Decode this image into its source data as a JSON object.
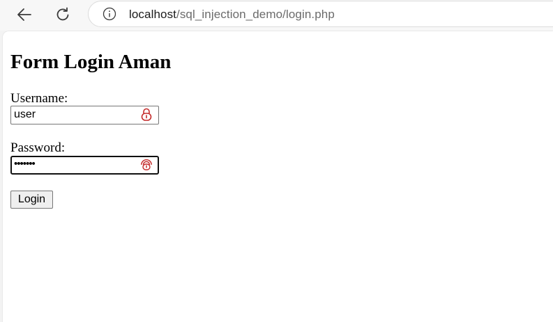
{
  "browser": {
    "url_host": "localhost",
    "url_path": "/sql_injection_demo/login.php"
  },
  "page": {
    "title": "Form Login Aman",
    "username_label": "Username:",
    "username_value": "user",
    "password_label": "Password:",
    "password_value": "•••••••",
    "login_button": "Login"
  },
  "colors": {
    "password_manager_icon": "#c42b2b"
  }
}
